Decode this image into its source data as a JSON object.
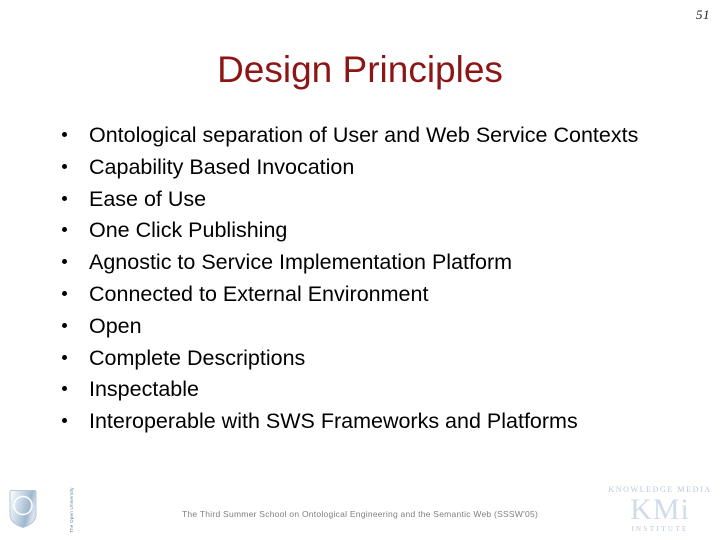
{
  "slide": {
    "page_number": "51",
    "title": "Design Principles",
    "title_color": "#8C1516",
    "background_color": "#FFFFFF",
    "text_color": "#000000"
  },
  "bullets": [
    {
      "text": "Ontological separation of User and Web Service Contexts"
    },
    {
      "text": "Capability Based Invocation"
    },
    {
      "text": "Ease of Use"
    },
    {
      "text": "One Click Publishing"
    },
    {
      "text": "Agnostic to Service Implementation Platform"
    },
    {
      "text": "Connected to External Environment"
    },
    {
      "text": "Open"
    },
    {
      "text": "Complete Descriptions"
    },
    {
      "text": "Inspectable"
    },
    {
      "text": "Interoperable with SWS Frameworks and Platforms"
    }
  ],
  "footer": {
    "text": "The Third Summer School on Ontological Engineering and the Semantic Web (SSSW'05)",
    "color": "#7F7F7F"
  },
  "logos": {
    "open_university": {
      "label": "The Open University",
      "icon": "shield-with-circle-icon",
      "color": "#6B7F90"
    },
    "kmi": {
      "top_line": "KNOWLEDGE MEDIA",
      "wordmark": "KMi",
      "bottom_line": "INSTITUTE",
      "color": "#C3D2E0"
    }
  }
}
